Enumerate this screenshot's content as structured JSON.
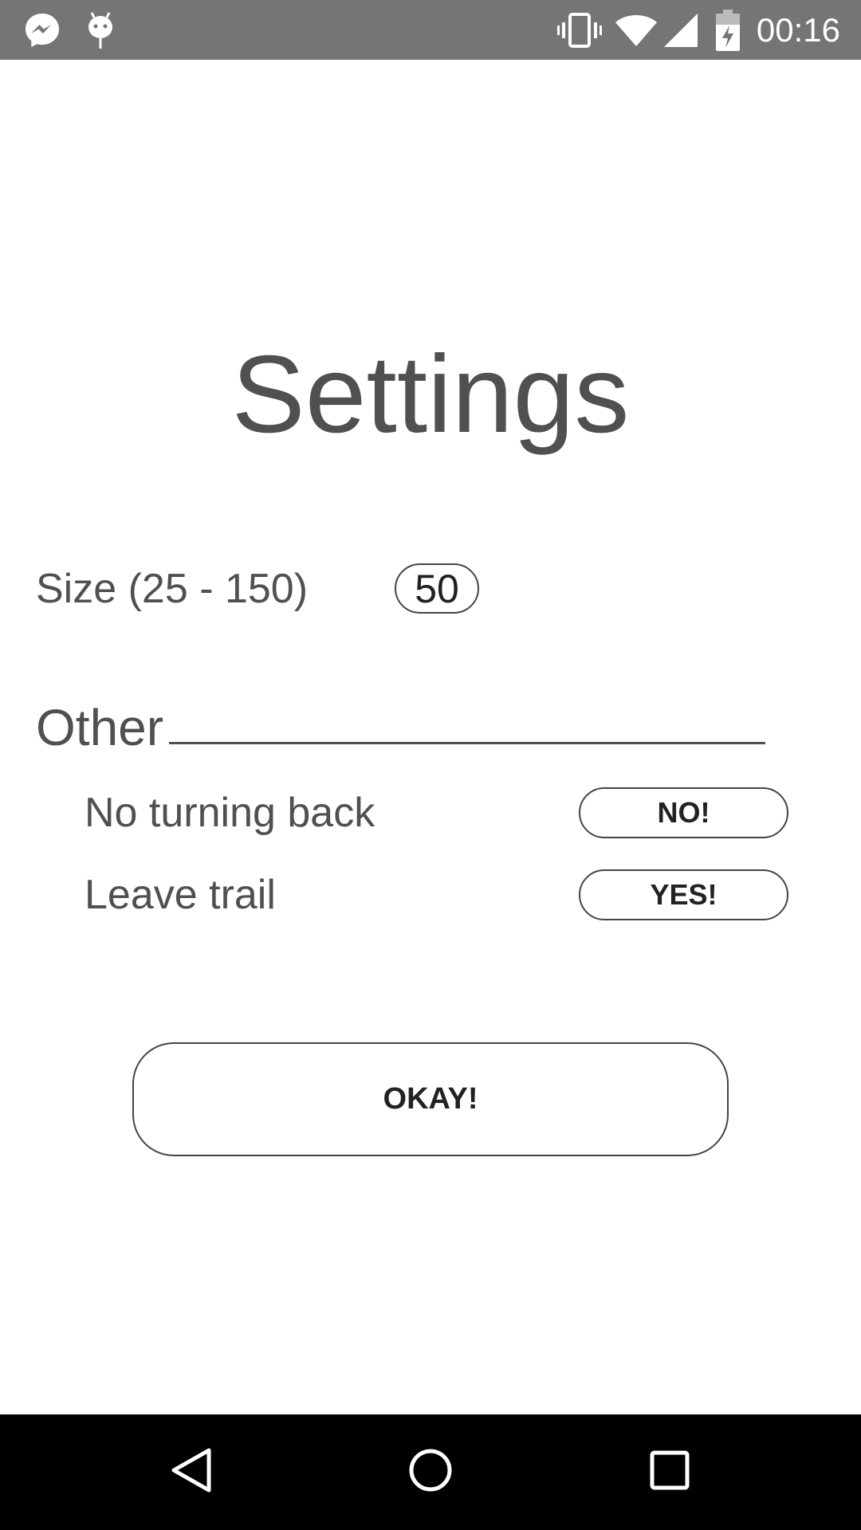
{
  "status_bar": {
    "time": "00:16",
    "left_icons": [
      "messenger-icon",
      "android-debug-icon"
    ],
    "right_icons": [
      "vibrate-icon",
      "wifi-icon",
      "signal-icon",
      "battery-charging-icon"
    ],
    "background": "#757575"
  },
  "page": {
    "title": "Settings"
  },
  "size": {
    "label": "Size (25 - 150)",
    "value": "50"
  },
  "other": {
    "header": "Other",
    "options": [
      {
        "label": "No turning back",
        "button": "NO!"
      },
      {
        "label": "Leave trail",
        "button": "YES!"
      }
    ]
  },
  "actions": {
    "okay_label": "OKAY!"
  },
  "nav_bar": {
    "buttons": [
      "back-icon",
      "home-icon",
      "recents-icon"
    ],
    "background": "#000000"
  }
}
